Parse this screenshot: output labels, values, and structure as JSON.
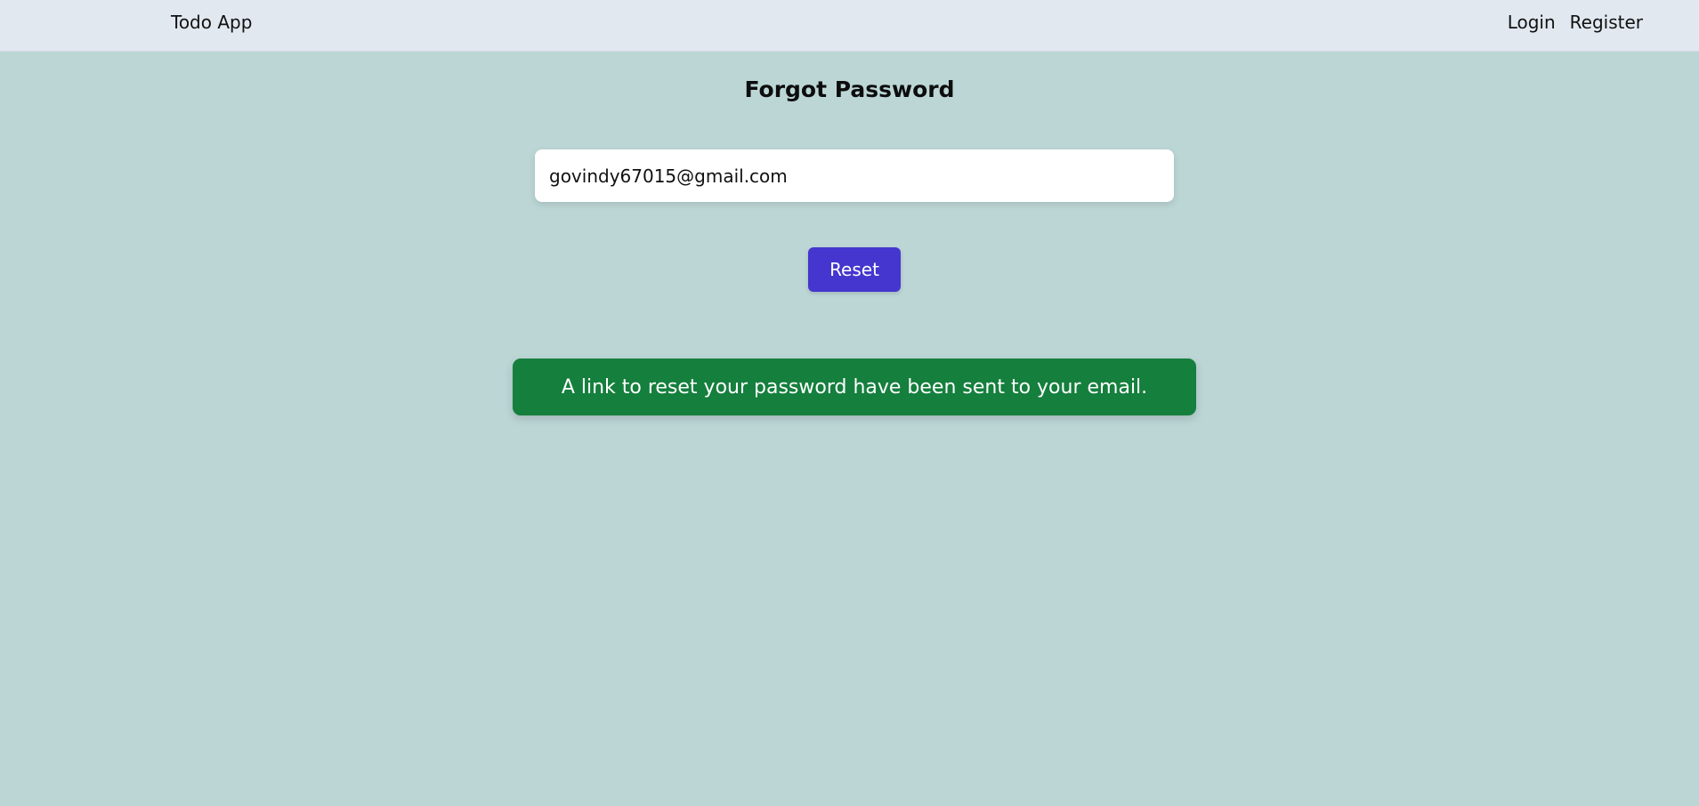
{
  "navbar": {
    "brand": "Todo App",
    "links": [
      {
        "label": "Login"
      },
      {
        "label": "Register"
      }
    ]
  },
  "main": {
    "title": "Forgot Password",
    "email_value": "govindy67015@gmail.com",
    "reset_label": "Reset",
    "alert_message": "A link to reset your password have been sent to your email."
  },
  "colors": {
    "page_background": "#bcd6d6",
    "navbar_background": "#e1e8f0",
    "button_background": "#4436cf",
    "alert_background": "#157f3d"
  }
}
